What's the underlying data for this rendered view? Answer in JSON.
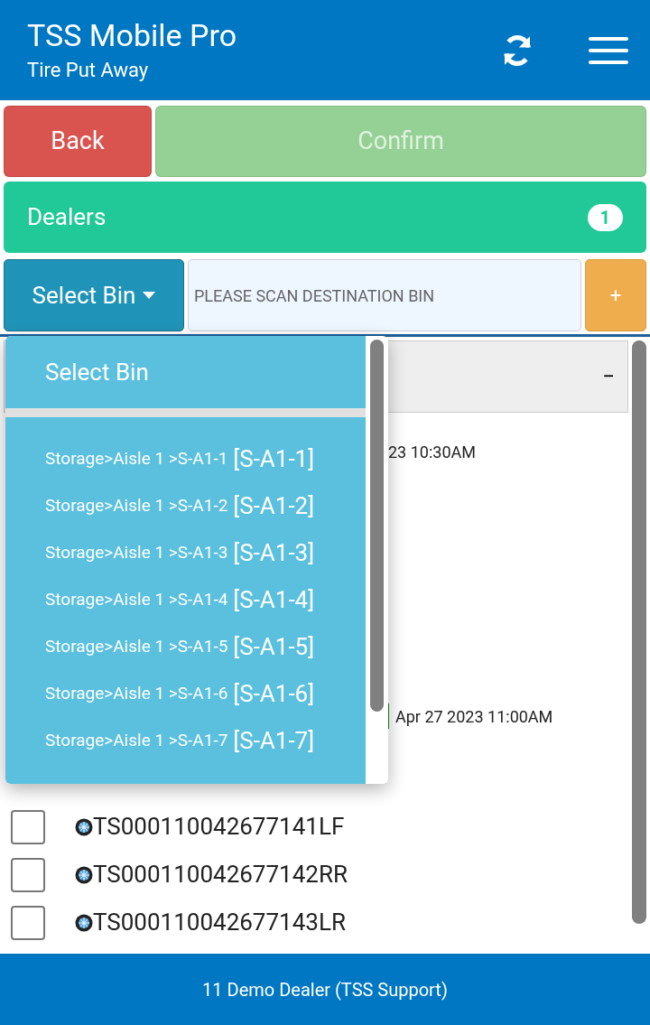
{
  "header": {
    "title": "TSS Mobile Pro",
    "subtitle": "Tire Put Away"
  },
  "actions": [
    {
      "label": "Back",
      "kind": "back",
      "disabled": false
    },
    {
      "label": "Confirm",
      "kind": "confirm",
      "disabled": true
    }
  ],
  "dealers": {
    "label": "Dealers",
    "count": "1"
  },
  "bin_bar": {
    "select_label": "Select Bin",
    "placeholder": "PLEASE SCAN DESTINATION BIN",
    "add_label": "+"
  },
  "panel": {
    "collapse_label": "−",
    "first_date": "23 10:30AM",
    "second_date": "Apr 27 2023 11:00AM",
    "tires": [
      {
        "serial": "TS000110042677141LF",
        "checked": false
      },
      {
        "serial": "TS000110042677142RR",
        "checked": false
      },
      {
        "serial": "TS000110042677143LR",
        "checked": false
      }
    ]
  },
  "dropdown": {
    "title": "Select Bin",
    "options": [
      {
        "path": "Storage>Aisle 1 >S-A1-1",
        "code": "[S-A1-1]"
      },
      {
        "path": "Storage>Aisle 1 >S-A1-2",
        "code": "[S-A1-2]"
      },
      {
        "path": "Storage>Aisle 1 >S-A1-3",
        "code": "[S-A1-3]"
      },
      {
        "path": "Storage>Aisle 1 >S-A1-4",
        "code": "[S-A1-4]"
      },
      {
        "path": "Storage>Aisle 1 >S-A1-5",
        "code": "[S-A1-5]"
      },
      {
        "path": "Storage>Aisle 1 >S-A1-6",
        "code": "[S-A1-6]"
      },
      {
        "path": "Storage>Aisle 1 >S-A1-7",
        "code": "[S-A1-7]"
      }
    ]
  },
  "footer": "11 Demo Dealer (TSS Support)"
}
